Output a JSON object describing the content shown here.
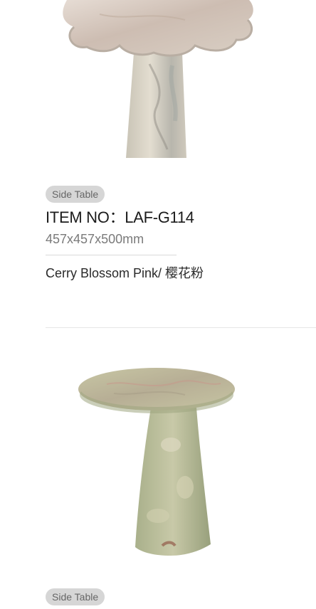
{
  "product_1": {
    "image_alt": "marble flower side table",
    "category": "Side Table",
    "item_no": "ITEM NO：LAF-G114",
    "dimensions": "457x457x500mm",
    "material": "Cerry Blossom Pink/ 樱花粉"
  },
  "product_2": {
    "image_alt": "green marble round side table",
    "category": "Side Table"
  },
  "colors": {
    "tag_background": "#d6d6d6",
    "tag_text": "#666666",
    "title_text": "#1b1b1b",
    "dimension_text": "#7a7a7a",
    "divider": "#d9d9d9"
  }
}
